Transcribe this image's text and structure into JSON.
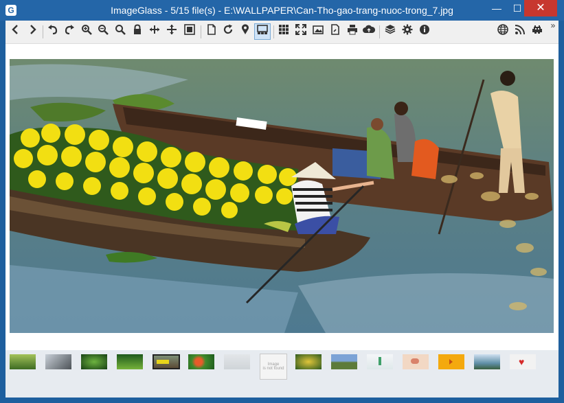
{
  "window": {
    "title": "ImageGlass - 5/15 file(s) - E:\\WALLPAPER\\Can-Tho-gao-trang-nuoc-trong_7.jpg",
    "app_icon_glyph": "G",
    "controls": {
      "minimize": "—",
      "maximize": "☐",
      "close": "✕"
    }
  },
  "toolbar": {
    "icons": [
      "arrow-left-icon",
      "arrow-right-icon",
      "rotate-left-icon",
      "rotate-right-icon",
      "zoom-in-icon",
      "zoom-out-icon",
      "zoom-actual-icon",
      "lock-icon",
      "scale-width-icon",
      "scale-height-icon",
      "auto-zoom-icon",
      "open-file-icon",
      "refresh-icon",
      "goto-icon",
      "thumbnail-icon",
      "checkerboard-icon",
      "fullscreen-icon",
      "slideshow-icon",
      "convert-icon",
      "print-icon",
      "upload-icon",
      "plugins-icon",
      "settings-icon",
      "about-icon",
      "globe-icon",
      "feed-icon",
      "bug-icon"
    ],
    "overflow_glyph": "»"
  },
  "thumbnails": {
    "count": 15,
    "selected_index": 4,
    "missing_label_line1": "Image",
    "missing_label_line2": "is not found"
  },
  "colors": {
    "titlebar": "#2466a8",
    "close": "#c7372f",
    "toolbar": "#f0f0f0",
    "thumbbar": "#e7ebf0",
    "active_button": "#cfe3f7"
  }
}
